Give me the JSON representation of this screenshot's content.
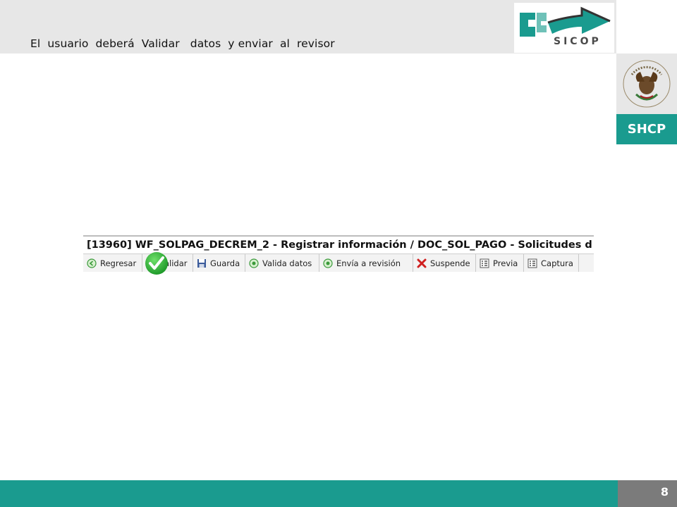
{
  "slide": {
    "title": "El  usuario  deberá  Validar   datos  y enviar  al  revisor",
    "page_number": "8"
  },
  "branding": {
    "sicop_label": "SICOP",
    "shcp_label": "SHCP",
    "accent_color": "#1a9b8f"
  },
  "app": {
    "window_title": "[13960]  WF_SOLPAG_DECREM_2 - Registrar información / DOC_SOL_PAGO - Solicitudes d",
    "toolbar": [
      {
        "label": "Regresar",
        "icon": "back-circle-icon"
      },
      {
        "label": "Validar",
        "icon": "check-circle-icon"
      },
      {
        "label": "Guarda",
        "icon": "save-disk-icon"
      },
      {
        "label": "Valida datos",
        "icon": "plus-circle-icon"
      },
      {
        "label": "Envía a revisión",
        "icon": "plus-circle-icon"
      },
      {
        "label": "Suspende",
        "icon": "red-x-icon"
      },
      {
        "label": "Previa",
        "icon": "document-list-icon"
      },
      {
        "label": "Captura",
        "icon": "document-list-icon"
      }
    ]
  }
}
